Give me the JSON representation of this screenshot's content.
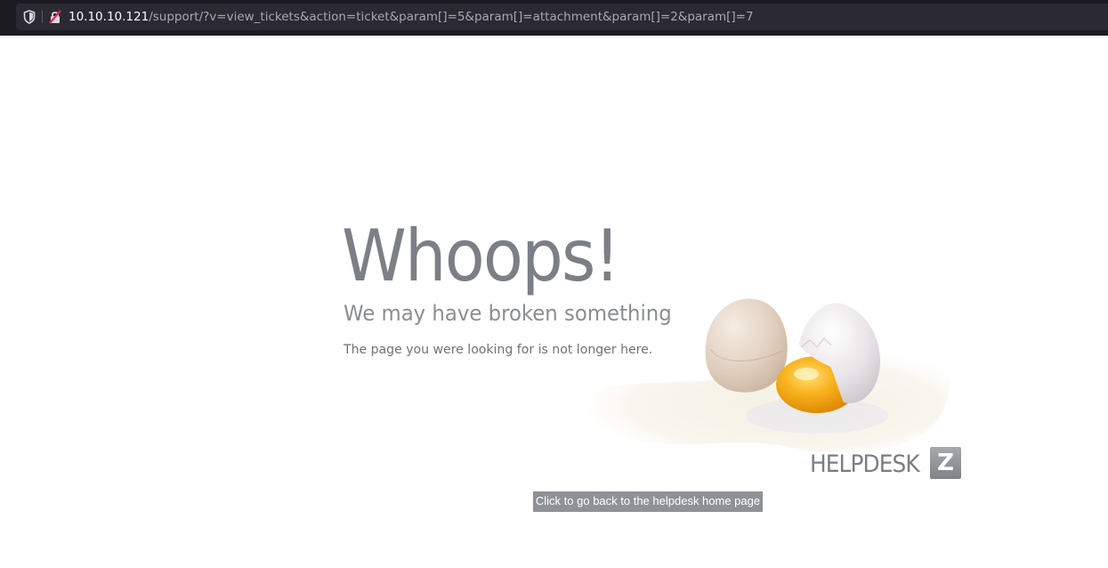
{
  "browser": {
    "url_host": "10.10.10.121",
    "url_path": "/support/?v=view_tickets&action=ticket&param[]=5&param[]=attachment&param[]=2&param[]=7",
    "icons": [
      "shield-icon",
      "insecure-lock-icon"
    ]
  },
  "error_page": {
    "heading": "Whoops!",
    "subtitle": "We may have broken something",
    "message": "The page you were looking for is not longer here.",
    "home_link": "Click to go back to the helpdesk home page",
    "logo_text": "HELPDESK",
    "logo_badge": "Z",
    "colors": {
      "text_gray": "#7b7f86",
      "button_bg": "#8e9196",
      "yolk": "#f7a31a"
    }
  }
}
